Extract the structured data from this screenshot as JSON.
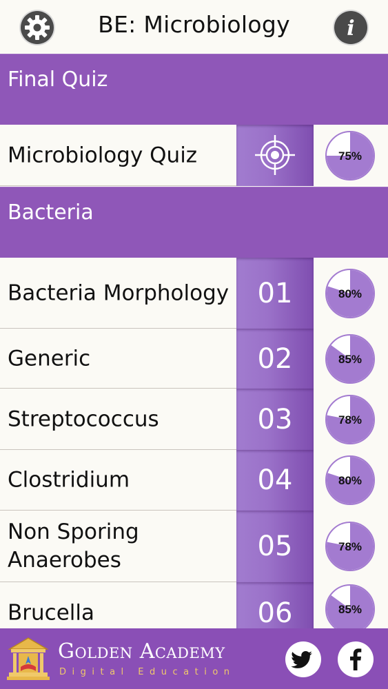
{
  "header": {
    "title": "BE: Microbiology",
    "left_icon": "gear-icon",
    "right_icon": "info-icon"
  },
  "sections": {
    "final_quiz": {
      "label": "Final Quiz"
    },
    "bacteria": {
      "label": "Bacteria"
    }
  },
  "quiz_row": {
    "name": "Microbiology Quiz",
    "icon": "target-icon",
    "score": "75%",
    "score_fraction": 0.75
  },
  "topics": [
    {
      "name": "Bacteria Morphology",
      "number": "01",
      "score": "80%",
      "score_fraction": 0.8
    },
    {
      "name": "Generic",
      "number": "02",
      "score": "85%",
      "score_fraction": 0.85
    },
    {
      "name": "Streptococcus",
      "number": "03",
      "score": "78%",
      "score_fraction": 0.78
    },
    {
      "name": "Clostridium",
      "number": "04",
      "score": "80%",
      "score_fraction": 0.8
    },
    {
      "name": "Non Sporing Anaerobes",
      "number": "05",
      "score": "78%",
      "score_fraction": 0.78
    },
    {
      "name": "Brucella",
      "number": "06",
      "score": "85%",
      "score_fraction": 0.85
    }
  ],
  "footer": {
    "brand": "Golden Academy",
    "tagline": "Digital Education",
    "social": [
      "twitter-icon",
      "facebook-icon"
    ]
  },
  "colors": {
    "accent": "#8f57b8",
    "pie_fill": "#a37bd0",
    "tagline": "#f0c96a"
  }
}
